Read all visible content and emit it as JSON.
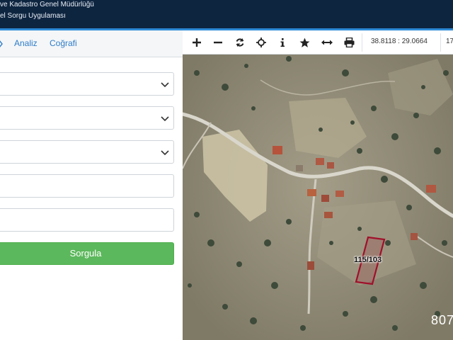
{
  "header": {
    "line1": "ve Kadastro Genel Müdürlüğü",
    "line2": "el Sorgu Uygulaması"
  },
  "tabs": [
    {
      "label": "Analiz"
    },
    {
      "label": "Coğrafi"
    }
  ],
  "form": {
    "submit_label": "Sorgula"
  },
  "map": {
    "coordinates": "38.8118 : 29.0664",
    "scale": "17",
    "parcel_label": "115/103",
    "corner_number": "807"
  },
  "colors": {
    "header_bg": "#0e2540",
    "accent": "#2e8ad6",
    "tab_link": "#2e7cc7",
    "submit_bg": "#5cb85c",
    "parcel_outline": "#a0102a"
  },
  "icons": [
    "plus-icon",
    "minus-icon",
    "refresh-icon",
    "crosshair-icon",
    "info-icon",
    "star-icon",
    "measure-icon",
    "print-icon",
    "chevron-down-icon"
  ]
}
